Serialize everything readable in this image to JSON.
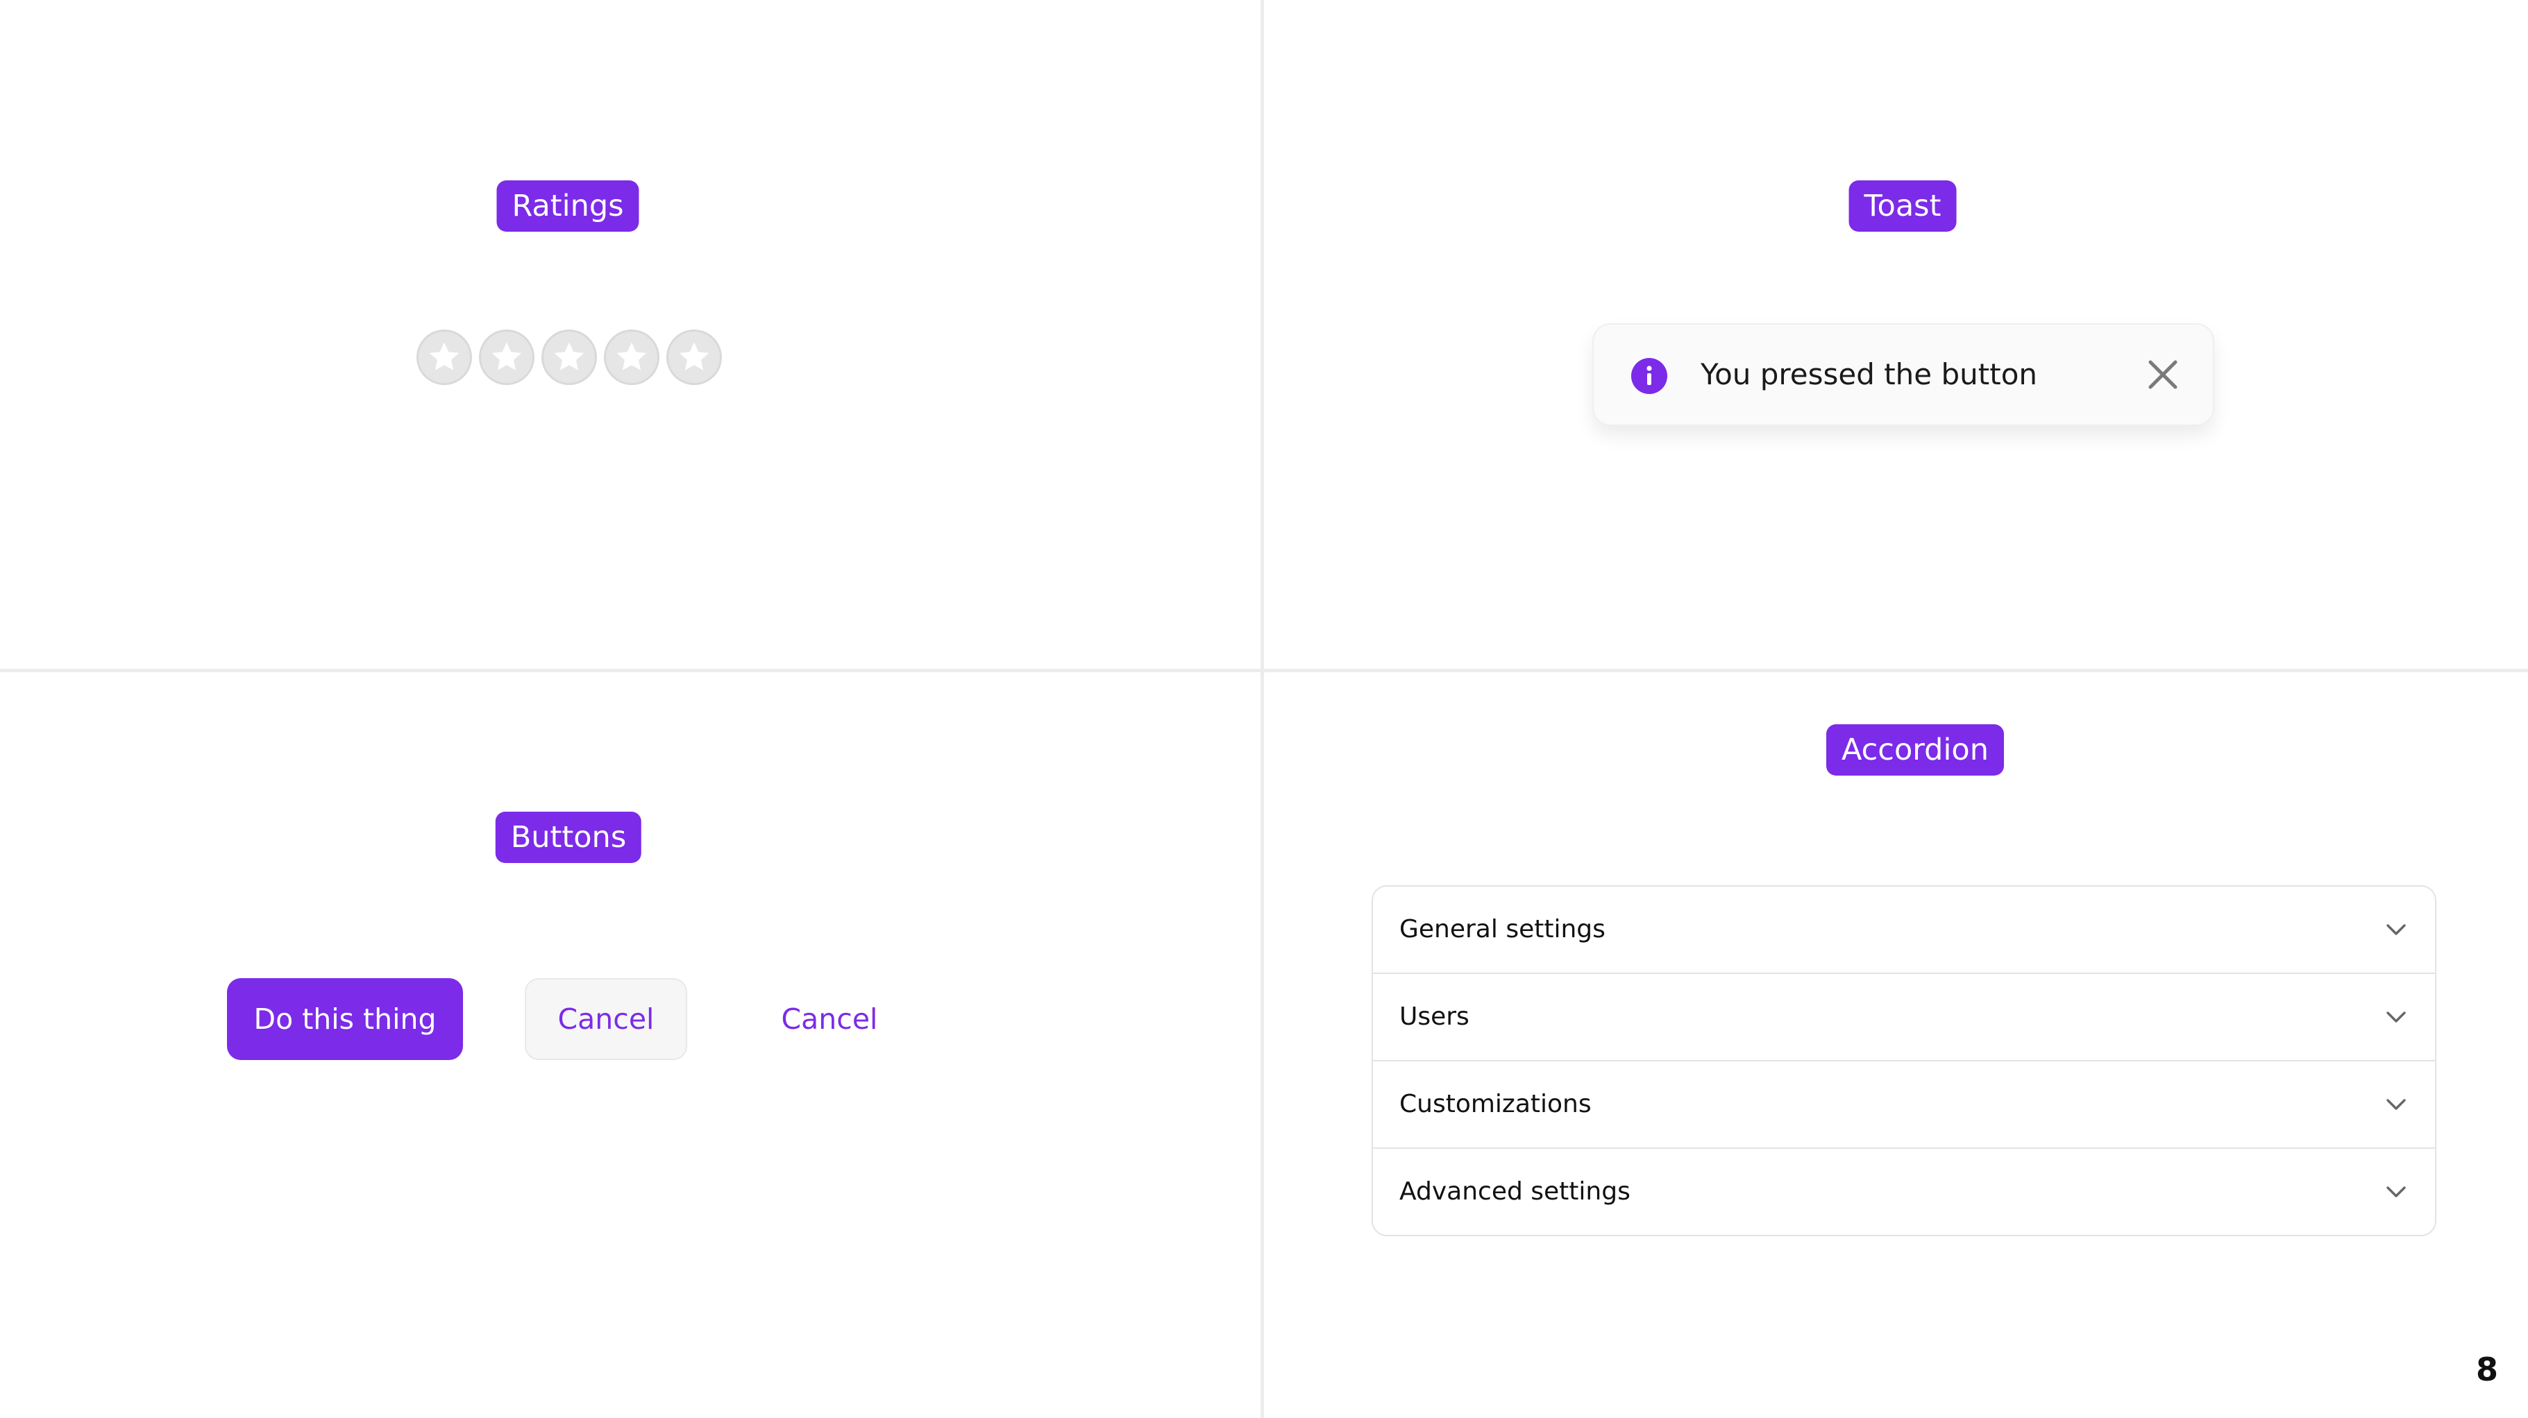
{
  "theme": {
    "accent_color": "#7c2be8",
    "divider_color": "#ececec",
    "star_color": "#e6e6e6"
  },
  "ratings": {
    "tag_label": "Ratings",
    "max_stars": 5,
    "selected_stars": 0
  },
  "toast": {
    "tag_label": "Toast",
    "icon": "info-icon",
    "message": "You pressed the button",
    "close_icon": "close-icon"
  },
  "buttons": {
    "tag_label": "Buttons",
    "primary_label": "Do this thing",
    "secondary_label": "Cancel",
    "tertiary_label": "Cancel"
  },
  "accordion": {
    "tag_label": "Accordion",
    "items": [
      {
        "label": "General settings",
        "icon": "chevron-down-icon"
      },
      {
        "label": "Users",
        "icon": "chevron-down-icon"
      },
      {
        "label": "Customizations",
        "icon": "chevron-down-icon"
      },
      {
        "label": "Advanced settings",
        "icon": "chevron-down-icon"
      }
    ]
  },
  "page_number": "8"
}
